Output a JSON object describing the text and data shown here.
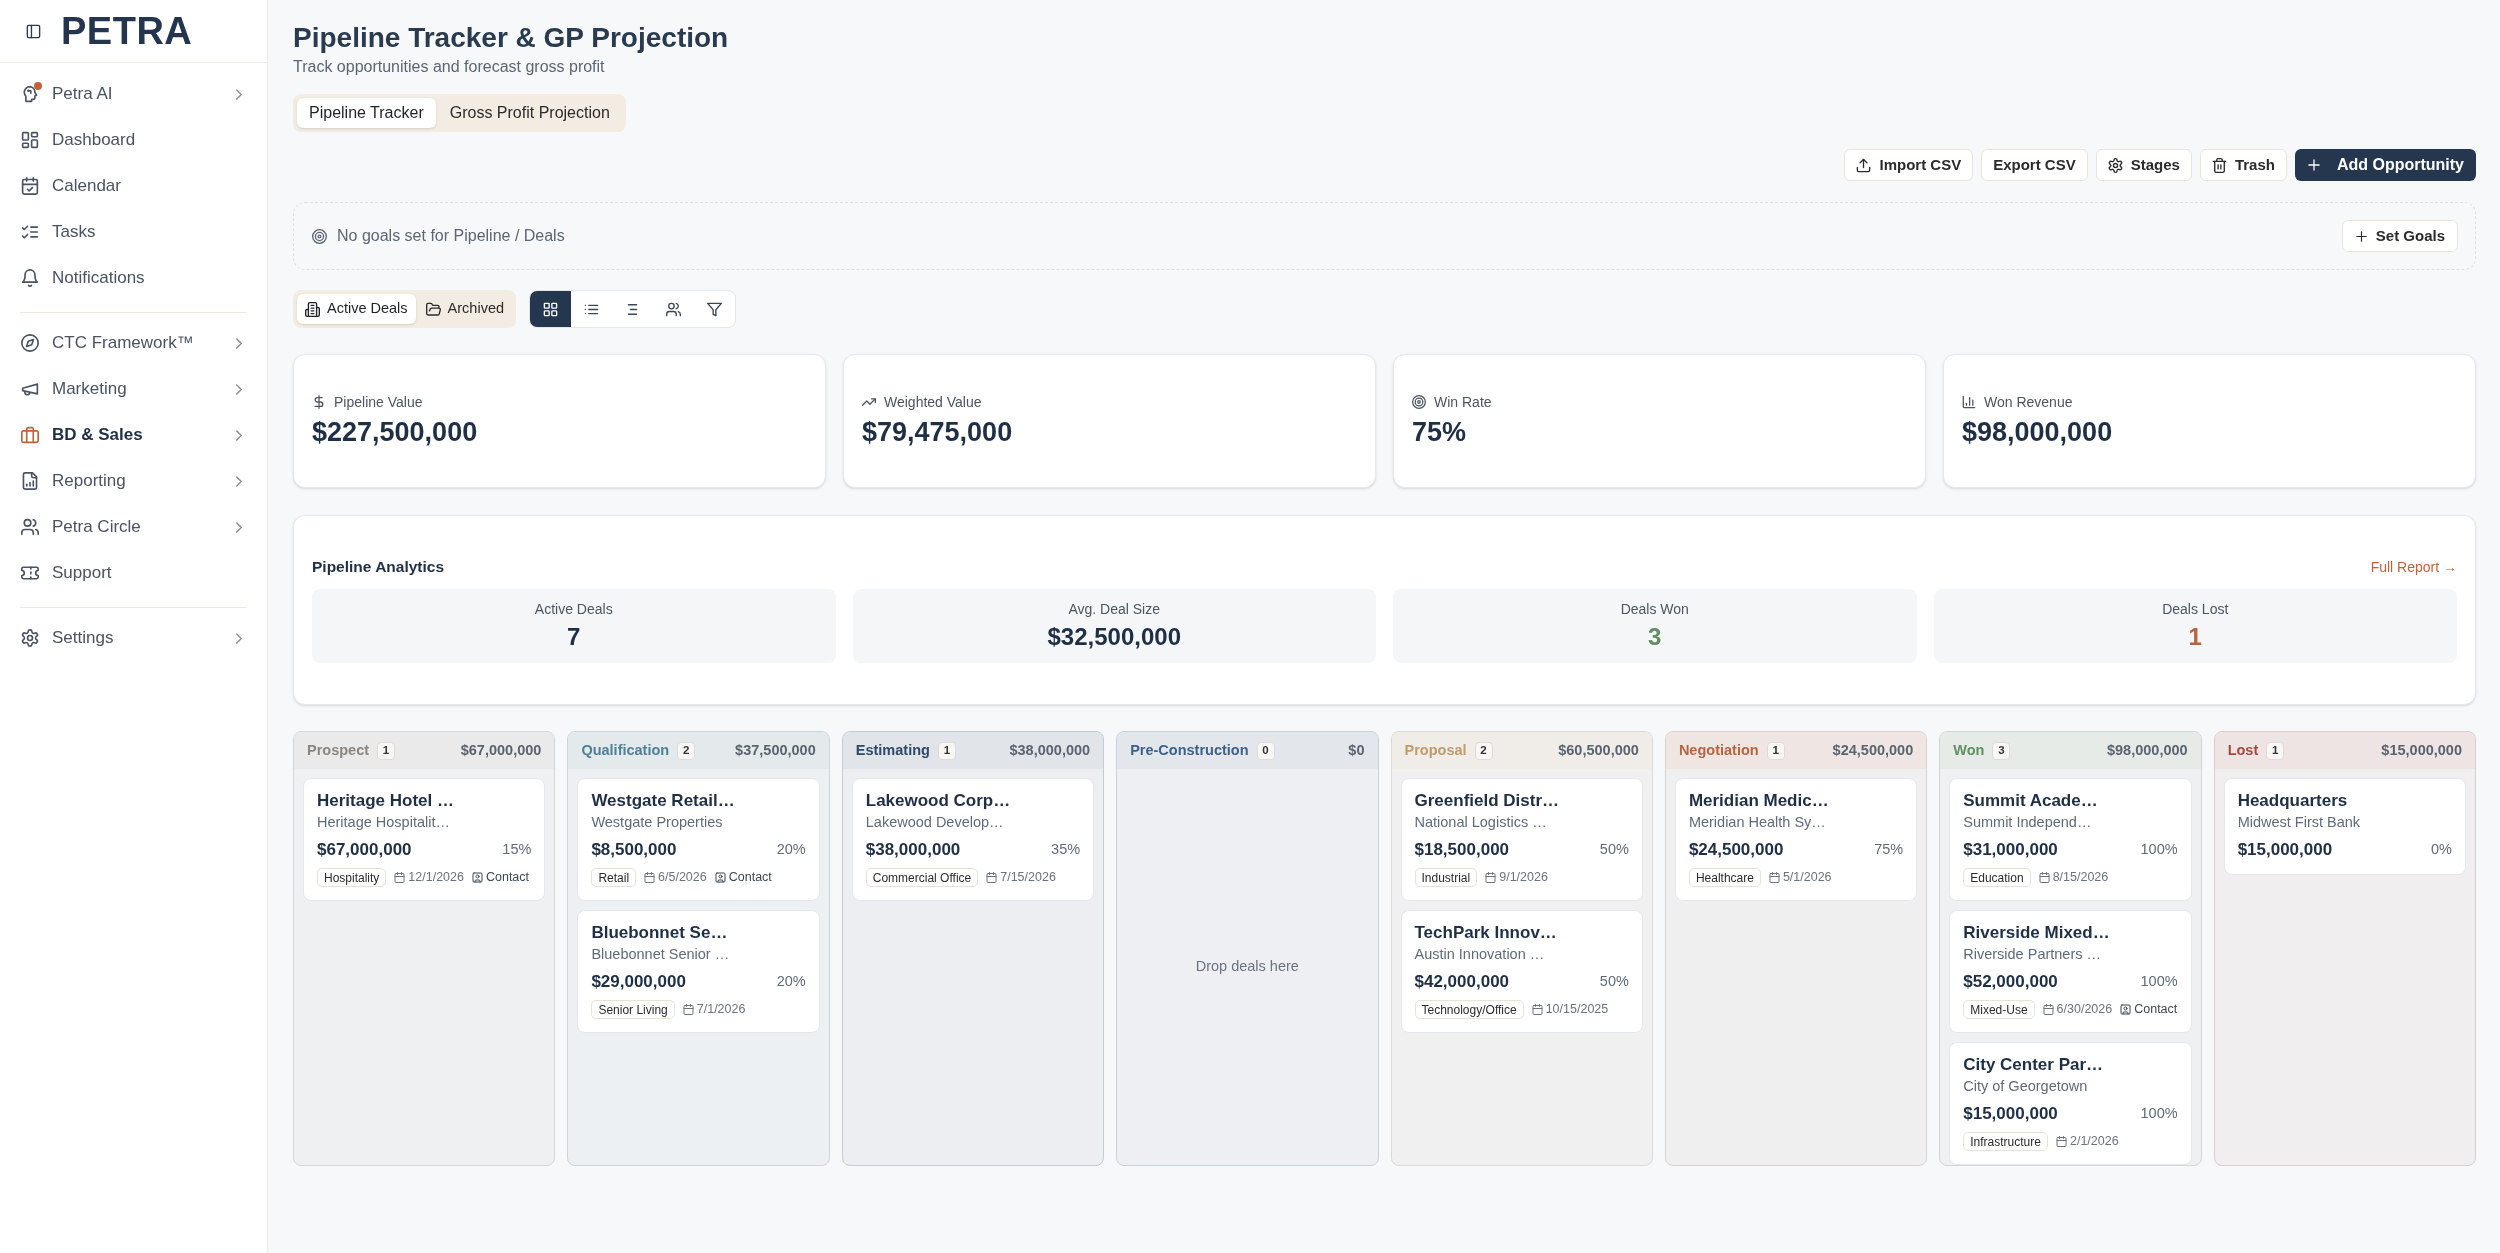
{
  "sidebar": {
    "logo": "PETRA",
    "sections": [
      {
        "items": [
          {
            "label": "Petra AI",
            "submenu": true,
            "selected": false,
            "notification": true
          },
          {
            "label": "Dashboard",
            "submenu": false,
            "selected": false,
            "notification": false
          },
          {
            "label": "Calendar",
            "submenu": false,
            "selected": false,
            "notification": false
          },
          {
            "label": "Tasks",
            "submenu": false,
            "selected": false,
            "notification": false
          },
          {
            "label": "Notifications",
            "submenu": false,
            "selected": false,
            "notification": false
          }
        ]
      },
      {
        "items": [
          {
            "label": "CTC Framework™",
            "submenu": true,
            "selected": false,
            "notification": false
          },
          {
            "label": "Marketing",
            "submenu": true,
            "selected": false,
            "notification": false
          },
          {
            "label": "BD & Sales",
            "submenu": true,
            "selected": true,
            "notification": false
          },
          {
            "label": "Reporting",
            "submenu": true,
            "selected": false,
            "notification": false
          },
          {
            "label": "Petra Circle",
            "submenu": true,
            "selected": false,
            "notification": false
          },
          {
            "label": "Support",
            "submenu": false,
            "selected": false,
            "notification": false
          }
        ]
      },
      {
        "items": [
          {
            "label": "Settings",
            "submenu": true,
            "selected": false,
            "notification": false
          }
        ]
      }
    ]
  },
  "header": {
    "title": "Pipeline Tracker & GP Projection",
    "subtitle": "Track opportunities and forecast gross profit"
  },
  "tabs": [
    {
      "label": "Pipeline Tracker",
      "selected": true
    },
    {
      "label": "Gross Profit Projection",
      "selected": false
    }
  ],
  "toolbar": [
    {
      "label": "Import CSV",
      "kind": "default"
    },
    {
      "label": "Export CSV",
      "kind": "default"
    },
    {
      "label": "Stages",
      "kind": "default"
    },
    {
      "label": "Trash",
      "kind": "default"
    },
    {
      "label": "Add Opportunity",
      "kind": "primary"
    }
  ],
  "goals": {
    "message": "No goals set for Pipeline / Deals",
    "button": "Set Goals"
  },
  "deal_filter": [
    {
      "label": "Active Deals",
      "selected": true
    },
    {
      "label": "Archived",
      "selected": false
    }
  ],
  "view_modes": [
    {
      "selected": true
    },
    {
      "selected": false
    },
    {
      "selected": false
    },
    {
      "selected": false
    },
    {
      "selected": false
    }
  ],
  "stats": [
    {
      "label": "Pipeline Value",
      "value": "$227,500,000"
    },
    {
      "label": "Weighted Value",
      "value": "$79,475,000"
    },
    {
      "label": "Win Rate",
      "value": "75%"
    },
    {
      "label": "Won Revenue",
      "value": "$98,000,000"
    }
  ],
  "analytics": {
    "title": "Pipeline Analytics",
    "link": "Full Report →",
    "metrics": [
      {
        "label": "Active Deals",
        "value": "7",
        "color": "#1f2f46"
      },
      {
        "label": "Avg. Deal Size",
        "value": "$32,500,000",
        "color": "#1f2f46"
      },
      {
        "label": "Deals Won",
        "value": "3",
        "color": "#5f8f62"
      },
      {
        "label": "Deals Lost",
        "value": "1",
        "color": "#b9633f"
      }
    ]
  },
  "stages": [
    {
      "name": "Prospect",
      "count": "1",
      "total": "$67,000,000",
      "color": "#8c8680",
      "cards": [
        {
          "title": "Heritage Hotel …",
          "client": "Heritage Hospitalit…",
          "amount": "$67,000,000",
          "probability": "15%",
          "tag": "Hospitality",
          "date": "12/1/2026",
          "contact": "Contact"
        }
      ]
    },
    {
      "name": "Qualification",
      "count": "2",
      "total": "$37,500,000",
      "color": "#4f8196",
      "cards": [
        {
          "title": "Westgate Retail…",
          "client": "Westgate Properties",
          "amount": "$8,500,000",
          "probability": "20%",
          "tag": "Retail",
          "date": "6/5/2026",
          "contact": "Contact"
        },
        {
          "title": "Bluebonnet Se…",
          "client": "Bluebonnet Senior …",
          "amount": "$29,000,000",
          "probability": "20%",
          "tag": "Senior Living",
          "date": "7/1/2026"
        }
      ]
    },
    {
      "name": "Estimating",
      "count": "1",
      "total": "$38,000,000",
      "color": "#2d4a6b",
      "cards": [
        {
          "title": "Lakewood Corp…",
          "client": "Lakewood Develop…",
          "amount": "$38,000,000",
          "probability": "35%",
          "tag": "Commercial Office",
          "date": "7/15/2026"
        }
      ]
    },
    {
      "name": "Pre-Construction",
      "count": "0",
      "total": "$0",
      "color": "#3d6189",
      "empty_text": "Drop deals here"
    },
    {
      "name": "Proposal",
      "count": "2",
      "total": "$60,500,000",
      "color": "#c39a6b",
      "cards": [
        {
          "title": "Greenfield Distr…",
          "client": "National Logistics …",
          "amount": "$18,500,000",
          "probability": "50%",
          "tag": "Industrial",
          "date": "9/1/2026"
        },
        {
          "title": "TechPark Innov…",
          "client": "Austin Innovation …",
          "amount": "$42,000,000",
          "probability": "50%",
          "tag": "Technology/Office",
          "date": "10/15/2025"
        }
      ]
    },
    {
      "name": "Negotiation",
      "count": "1",
      "total": "$24,500,000",
      "color": "#b9633f",
      "cards": [
        {
          "title": "Meridian Medic…",
          "client": "Meridian Health Sy…",
          "amount": "$24,500,000",
          "probability": "75%",
          "tag": "Healthcare",
          "date": "5/1/2026"
        }
      ]
    },
    {
      "name": "Won",
      "count": "3",
      "total": "$98,000,000",
      "color": "#5f8f62",
      "cards": [
        {
          "title": "Summit Acade…",
          "client": "Summit Independ…",
          "amount": "$31,000,000",
          "probability": "100%",
          "tag": "Education",
          "date": "8/15/2026"
        },
        {
          "title": "Riverside Mixed…",
          "client": "Riverside Partners …",
          "amount": "$52,000,000",
          "probability": "100%",
          "tag": "Mixed-Use",
          "date": "6/30/2026",
          "contact": "Contact"
        },
        {
          "title": "City Center Par…",
          "client": "City of Georgetown",
          "amount": "$15,000,000",
          "probability": "100%",
          "tag": "Infrastructure",
          "date": "2/1/2026"
        }
      ]
    },
    {
      "name": "Lost",
      "count": "1",
      "total": "$15,000,000",
      "color": "#a8473b",
      "cards": [
        {
          "title": "Headquarters",
          "client": "Midwest First Bank",
          "amount": "$15,000,000",
          "probability": "0%"
        }
      ]
    }
  ]
}
